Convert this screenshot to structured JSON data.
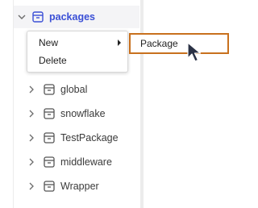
{
  "tree": {
    "root": {
      "label": "packages",
      "expanded": true,
      "icon": "package-icon"
    },
    "items": [
      {
        "label": "global",
        "icon": "package-icon"
      },
      {
        "label": "snowflake",
        "icon": "package-icon"
      },
      {
        "label": "TestPackage",
        "icon": "package-icon"
      },
      {
        "label": "middleware",
        "icon": "package-icon"
      },
      {
        "label": "Wrapper",
        "icon": "package-icon"
      }
    ]
  },
  "context_menu": {
    "items": [
      {
        "label": "New",
        "has_submenu": true
      },
      {
        "label": "Delete",
        "has_submenu": false
      }
    ]
  },
  "submenu": {
    "items": [
      {
        "label": "Package",
        "highlighted": true
      }
    ]
  },
  "colors": {
    "accent": "#3a4fd6",
    "highlight_border": "#c8701e",
    "cursor": "#2b3245"
  }
}
